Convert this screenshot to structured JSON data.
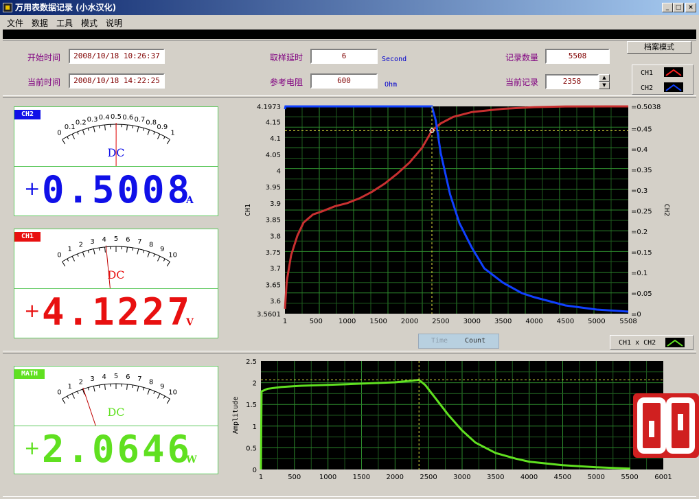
{
  "window": {
    "title": "万用表数据记录 (小水汉化)"
  },
  "menu": [
    "文件",
    "数据",
    "工具",
    "模式",
    "说明"
  ],
  "header": {
    "start_time_label": "开始时间",
    "start_time": "2008/10/18 10:26:37",
    "current_time_label": "当前时间",
    "current_time": "2008/10/18 14:22:25",
    "sample_delay_label": "取样延时",
    "sample_delay": "6",
    "sample_delay_unit": "Second",
    "ref_resistor_label": "参考电阻",
    "ref_resistor": "600",
    "ref_resistor_unit": "Ohm",
    "record_count_label": "记录数量",
    "record_count": "5508",
    "current_record_label": "当前记录",
    "current_record": "2358",
    "mode_button": "档案模式",
    "legend": [
      {
        "name": "CH1",
        "color": "#ff2020"
      },
      {
        "name": "CH2",
        "color": "#1040ff"
      }
    ]
  },
  "meters": [
    {
      "tag": "CH2",
      "tag_color": "#1010e8",
      "scale": [
        "0",
        "0.1",
        "0.2",
        "0.3",
        "0.4",
        "0.5",
        "0.6",
        "0.7",
        "0.8",
        "0.9",
        "1"
      ],
      "needle_fraction": 0.5008,
      "mode": "DC",
      "sign": "+",
      "value": "0.5008",
      "unit": "A",
      "color": "#1010e8"
    },
    {
      "tag": "CH1",
      "tag_color": "#e81010",
      "scale": [
        "0",
        "1",
        "2",
        "3",
        "4",
        "5",
        "6",
        "7",
        "8",
        "9",
        "10"
      ],
      "needle_fraction": 0.41227,
      "mode": "DC",
      "sign": "+",
      "value": "4.1227",
      "unit": "V",
      "color": "#e81010"
    },
    {
      "tag": "MATH",
      "tag_color": "#60e020",
      "scale": [
        "0",
        "1",
        "2",
        "3",
        "4",
        "5",
        "6",
        "7",
        "8",
        "9",
        "10"
      ],
      "needle_fraction": 0.20646,
      "mode": "DC",
      "sign": "+",
      "value": "2.0646",
      "unit": "W",
      "color": "#60e020"
    }
  ],
  "chart_toggle": {
    "time": "Time",
    "count": "Count"
  },
  "math_legend": {
    "label": "CH1 x CH2",
    "color": "#60e020"
  },
  "chart_data": [
    {
      "type": "line",
      "xlim": [
        1,
        5508
      ],
      "x_ticks": [
        "1",
        "500",
        "1000",
        "1500",
        "2000",
        "2500",
        "3000",
        "3500",
        "4000",
        "4500",
        "5000",
        "5508"
      ],
      "ylabel_left": "CH1",
      "ylim_left": [
        3.5601,
        4.1973
      ],
      "y_ticks_left": [
        "4.1973",
        "4.15",
        "4.1",
        "4.05",
        "4",
        "3.95",
        "3.9",
        "3.85",
        "3.8",
        "3.75",
        "3.7",
        "3.65",
        "3.6",
        "3.5601"
      ],
      "ylabel_right": "CH2",
      "ylim_right": [
        0,
        0.5038
      ],
      "y_ticks_right": [
        "0.5038",
        "0.45",
        "0.4",
        "0.35",
        "0.3",
        "0.25",
        "0.2",
        "0.15",
        "0.1",
        "0.05",
        "0"
      ],
      "cursor": {
        "x": 2358,
        "y_left": 4.1227
      },
      "grid": true,
      "series": [
        {
          "name": "CH1",
          "color": "#c83030",
          "axis": "left",
          "points": [
            [
              1,
              3.575
            ],
            [
              30,
              3.66
            ],
            [
              100,
              3.74
            ],
            [
              200,
              3.8
            ],
            [
              300,
              3.84
            ],
            [
              450,
              3.865
            ],
            [
              600,
              3.875
            ],
            [
              800,
              3.89
            ],
            [
              1000,
              3.9
            ],
            [
              1200,
              3.915
            ],
            [
              1400,
              3.935
            ],
            [
              1600,
              3.96
            ],
            [
              1800,
              3.99
            ],
            [
              2000,
              4.025
            ],
            [
              2200,
              4.07
            ],
            [
              2358,
              4.1227
            ],
            [
              2500,
              4.145
            ],
            [
              2700,
              4.165
            ],
            [
              3000,
              4.18
            ],
            [
              3500,
              4.19
            ],
            [
              4000,
              4.195
            ],
            [
              4500,
              4.197
            ],
            [
              5508,
              4.1973
            ]
          ]
        },
        {
          "name": "CH2",
          "color": "#1040ff",
          "axis": "right",
          "points": [
            [
              1,
              0.497
            ],
            [
              10,
              0.5038
            ],
            [
              2358,
              0.5038
            ],
            [
              2420,
              0.47
            ],
            [
              2500,
              0.39
            ],
            [
              2650,
              0.29
            ],
            [
              2800,
              0.22
            ],
            [
              3000,
              0.16
            ],
            [
              3200,
              0.11
            ],
            [
              3500,
              0.075
            ],
            [
              3800,
              0.05
            ],
            [
              4000,
              0.04
            ],
            [
              4500,
              0.02
            ],
            [
              5000,
              0.01
            ],
            [
              5508,
              0.005
            ]
          ]
        }
      ]
    },
    {
      "type": "line",
      "xlim": [
        1,
        6001
      ],
      "x_ticks": [
        "1",
        "500",
        "1000",
        "1500",
        "2000",
        "2500",
        "3000",
        "3500",
        "4000",
        "4500",
        "5000",
        "5500",
        "6001"
      ],
      "ylabel": "Amplitude",
      "ylim": [
        0,
        2.5
      ],
      "y_ticks": [
        "2.5",
        "2",
        "1.5",
        "1",
        "0.5",
        "0"
      ],
      "cursor": {
        "x": 2358,
        "y": 2.0646
      },
      "grid": true,
      "series": [
        {
          "name": "CH1 x CH2",
          "color": "#60e020",
          "points": [
            [
              1,
              0
            ],
            [
              10,
              1.8
            ],
            [
              100,
              1.86
            ],
            [
              300,
              1.9
            ],
            [
              600,
              1.93
            ],
            [
              1000,
              1.95
            ],
            [
              1500,
              1.98
            ],
            [
              2000,
              2.01
            ],
            [
              2358,
              2.0646
            ],
            [
              2450,
              1.95
            ],
            [
              2600,
              1.65
            ],
            [
              2800,
              1.25
            ],
            [
              3000,
              0.9
            ],
            [
              3200,
              0.62
            ],
            [
              3500,
              0.38
            ],
            [
              3800,
              0.25
            ],
            [
              4000,
              0.18
            ],
            [
              4500,
              0.1
            ],
            [
              5000,
              0.05
            ],
            [
              5508,
              0.02
            ]
          ]
        }
      ]
    }
  ]
}
